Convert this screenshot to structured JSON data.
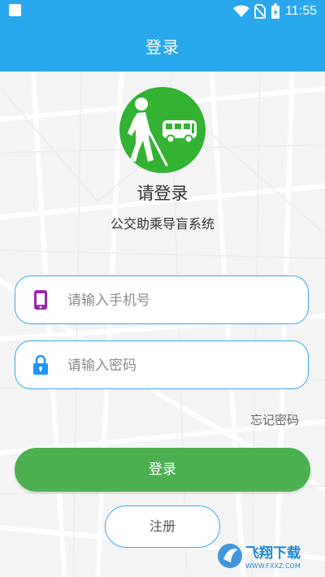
{
  "status_bar": {
    "time": "11:55"
  },
  "header": {
    "title": "登录"
  },
  "main": {
    "title": "请登录",
    "subtitle": "公交助乘导盲系统"
  },
  "form": {
    "phone_placeholder": "请输入手机号",
    "password_placeholder": "请输入密码",
    "forgot_label": "忘记密码",
    "login_label": "登录",
    "register_label": "注册"
  },
  "watermark": {
    "text_main": "飞翔下载",
    "text_sub": "WWW.FXXZ.COM"
  },
  "colors": {
    "header_blue": "#2aa8ee",
    "input_border": "#3aa9ea",
    "login_green": "#4caf50",
    "logo_green": "#34b233",
    "phone_icon_purple": "#9c27b0",
    "lock_icon_blue": "#2196f3"
  },
  "icons": {
    "phone": "phone-icon",
    "lock": "lock-icon",
    "wifi": "wifi-icon",
    "battery": "battery-icon"
  }
}
